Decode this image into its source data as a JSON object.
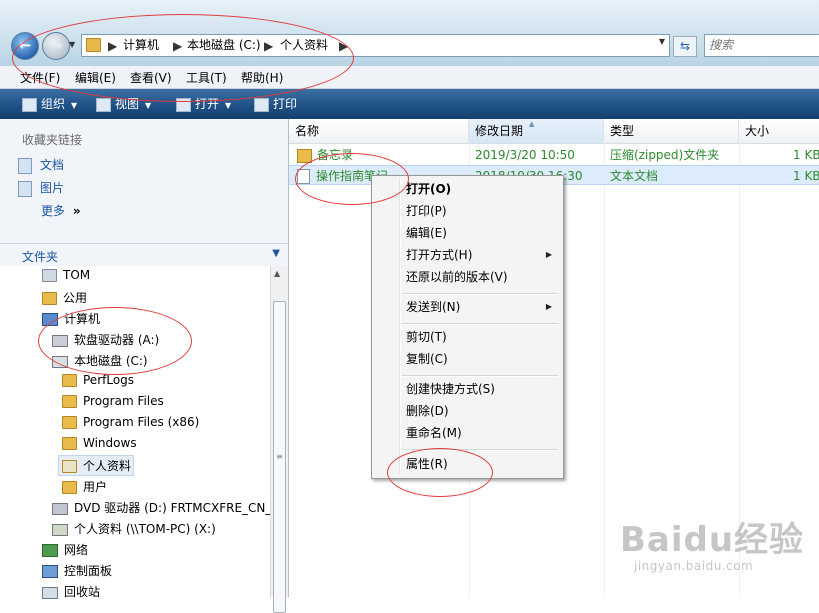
{
  "address_bar": {
    "breadcrumb": [
      "计算机",
      "本地磁盘 (C:)",
      "个人资料"
    ],
    "search_placeholder": "搜索"
  },
  "menu": [
    "文件(F)",
    "编辑(E)",
    "查看(V)",
    "工具(T)",
    "帮助(H)"
  ],
  "toolbar": {
    "organize": "组织",
    "views": "视图",
    "open": "打开",
    "print": "打印"
  },
  "favorites": {
    "title": "收藏夹链接",
    "items": [
      "文档",
      "图片",
      "更多"
    ],
    "more_glyph": "»"
  },
  "folders": {
    "title": "文件夹",
    "tree": [
      {
        "label": "TOM",
        "icon": "user-folder-icon"
      },
      {
        "label": "公用",
        "icon": "folder-icon"
      },
      {
        "label": "计算机",
        "icon": "computer-icon"
      },
      {
        "label": "软盘驱动器 (A:)",
        "icon": "floppy-drive-icon"
      },
      {
        "label": "本地磁盘 (C:)",
        "icon": "local-disk-icon"
      },
      {
        "label": "PerfLogs",
        "icon": "folder-icon"
      },
      {
        "label": "Program Files",
        "icon": "folder-icon"
      },
      {
        "label": "Program Files (x86)",
        "icon": "folder-icon"
      },
      {
        "label": "Windows",
        "icon": "folder-icon"
      },
      {
        "label": "个人资料",
        "icon": "folder-icon",
        "selected": true
      },
      {
        "label": "用户",
        "icon": "folder-icon"
      },
      {
        "label": "DVD 驱动器 (D:) FRTMCXFRE_CN_I",
        "icon": "dvd-drive-icon"
      },
      {
        "label": "个人资料 (\\\\TOM-PC) (X:)",
        "icon": "network-drive-icon"
      },
      {
        "label": "网络",
        "icon": "network-icon"
      },
      {
        "label": "控制面板",
        "icon": "control-panel-icon"
      },
      {
        "label": "回收站",
        "icon": "recycle-bin-icon"
      }
    ]
  },
  "columns": [
    "名称",
    "修改日期",
    "类型",
    "大小"
  ],
  "files": [
    {
      "name": "备忘录",
      "modified": "2019/3/20 10:50",
      "type": "压缩(zipped)文件夹",
      "size": "1 KB",
      "icon": "zip-folder-icon"
    },
    {
      "name": "操作指南笔记",
      "modified": "2018/10/30 16:30",
      "type": "文本文档",
      "size": "1 KB",
      "icon": "text-file-icon",
      "selected": true
    }
  ],
  "context_menu": {
    "items": [
      {
        "label": "打开(O)",
        "bold": true
      },
      {
        "label": "打印(P)"
      },
      {
        "label": "编辑(E)"
      },
      {
        "label": "打开方式(H)",
        "submenu": true
      },
      {
        "label": "还原以前的版本(V)"
      },
      {
        "separator": true
      },
      {
        "label": "发送到(N)",
        "submenu": true
      },
      {
        "separator": true
      },
      {
        "label": "剪切(T)"
      },
      {
        "label": "复制(C)"
      },
      {
        "separator": true
      },
      {
        "label": "创建快捷方式(S)"
      },
      {
        "label": "删除(D)"
      },
      {
        "label": "重命名(M)"
      },
      {
        "separator": true
      },
      {
        "label": "属性(R)"
      }
    ]
  },
  "watermark": {
    "logo": "Baidu经验",
    "url": "jingyan.baidu.com"
  },
  "colors": {
    "annotation": "#e23a3a",
    "toolbar_bg": "#1d4f84",
    "link_blue": "#1a55a6",
    "file_text_green": "#2d8a2d",
    "selection": "#dcecfc"
  }
}
